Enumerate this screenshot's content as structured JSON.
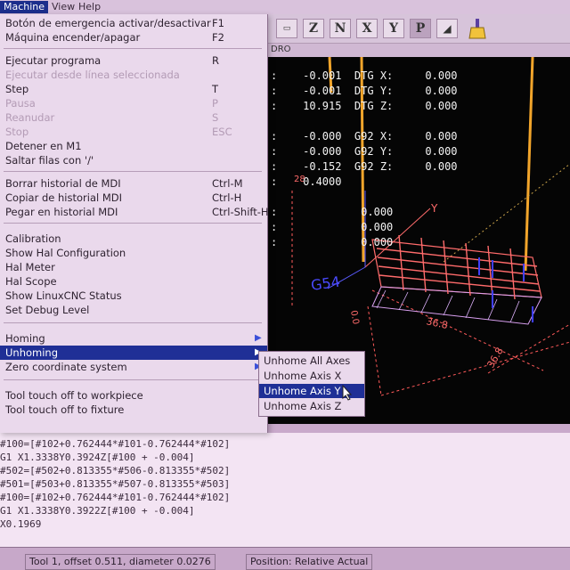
{
  "menubar": {
    "machine": "Machine",
    "view": "View",
    "help": "Help"
  },
  "toolbar": {
    "btn_z": "Z",
    "btn_z2": "N",
    "btn_x": "X",
    "btn_y": "Y",
    "btn_p": "P"
  },
  "tab": {
    "dro": "DRO"
  },
  "dro": {
    "r1": ":    -0.001  DTG X:     0.000",
    "r2": ":    -0.001  DTG Y:     0.000",
    "r3": ":    10.915  DTG Z:     0.000",
    "r4": ":    -0.000  G92 X:     0.000",
    "r5": ":    -0.000  G92 Y:     0.000",
    "r6": ":    -0.152  G92 Z:     0.000",
    "r7": ":    0.4000",
    "r8": ":             0.000",
    "r9": ":             0.000",
    "r10": ":             0.000"
  },
  "preview": {
    "dim_x": "36.8",
    "dim_y": "36.8",
    "origin_label": "0.0",
    "left_label": "28",
    "axis_label": "G54",
    "y_label": "Y"
  },
  "menu": {
    "items": [
      {
        "label": "Botón de emergencia activar/desactivar",
        "accel": "F1"
      },
      {
        "label": "Máquina encender/apagar",
        "accel": "F2"
      },
      {
        "label": "Ejecutar programa",
        "accel": "R"
      },
      {
        "label": "Ejecutar desde línea seleccionada",
        "accel": ""
      },
      {
        "label": "Step",
        "accel": "T"
      },
      {
        "label": "Pausa",
        "accel": "P"
      },
      {
        "label": "Reanudar",
        "accel": "S"
      },
      {
        "label": "Stop",
        "accel": "ESC"
      },
      {
        "label": "Detener en M1",
        "accel": ""
      },
      {
        "label": "Saltar filas con '/'",
        "accel": ""
      },
      {
        "label": "Borrar historial de MDI",
        "accel": "Ctrl-M"
      },
      {
        "label": "Copiar de historial MDI",
        "accel": "Ctrl-H"
      },
      {
        "label": "Pegar en historial MDI",
        "accel": "Ctrl-Shift-H"
      },
      {
        "label": "Calibration",
        "accel": ""
      },
      {
        "label": "Show Hal Configuration",
        "accel": ""
      },
      {
        "label": "Hal Meter",
        "accel": ""
      },
      {
        "label": "Hal Scope",
        "accel": ""
      },
      {
        "label": "Show LinuxCNC Status",
        "accel": ""
      },
      {
        "label": "Set Debug Level",
        "accel": ""
      },
      {
        "label": "Homing",
        "accel": ""
      },
      {
        "label": "Unhoming",
        "accel": ""
      },
      {
        "label": "Zero coordinate system",
        "accel": ""
      },
      {
        "label": "Tool touch off to workpiece",
        "accel": ""
      },
      {
        "label": "Tool touch off to fixture",
        "accel": ""
      }
    ]
  },
  "submenu": {
    "items": [
      "Unhome All Axes",
      "Unhome Axis X",
      "Unhome Axis Y",
      "Unhome Axis Z"
    ]
  },
  "gcode": {
    "lines": [
      "#100=[#102+0.762444*#101-0.762444*#102]",
      "G1 X1.3338Y0.3924Z[#100 + -0.004]",
      "#502=[#502+0.813355*#506-0.813355*#502]",
      "#501=[#503+0.813355*#507-0.813355*#503]",
      "#100=[#102+0.762444*#101-0.762444*#102]",
      "G1 X1.3338Y0.3922Z[#100 + -0.004]",
      "X0.1969"
    ]
  },
  "status": {
    "tool": "Tool 1, offset 0.511, diameter 0.0276",
    "position": "Position: Relative Actual"
  },
  "colors": {
    "menu_highlight": "#1f2f96",
    "preview_bg": "#050505",
    "toolpath": "#ff6b6b",
    "rapid": "#f2a52b"
  }
}
